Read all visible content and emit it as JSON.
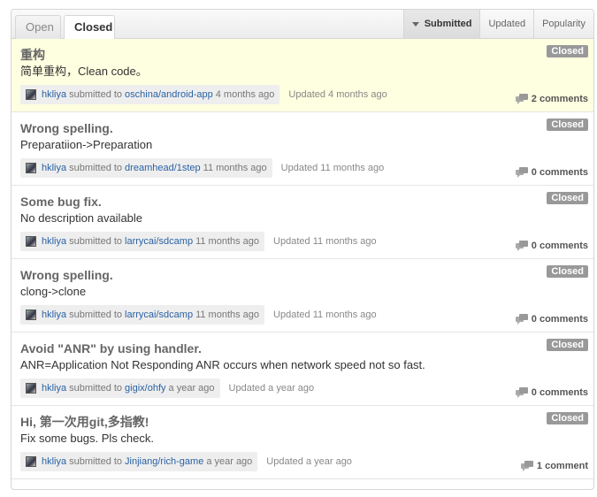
{
  "tabs": {
    "open": "Open",
    "closed": "Closed"
  },
  "sort": {
    "submitted": "Submitted",
    "updated": "Updated",
    "popularity": "Popularity"
  },
  "pulls": [
    {
      "title": "重构",
      "desc": "简单重构，Clean code。",
      "user": "hkliya",
      "submitted_to": "submitted to",
      "repo": "oschina/android-app",
      "ago": "4 months ago",
      "updated": "Updated 4 months ago",
      "state": "Closed",
      "comments": "2 comments",
      "highlight": true
    },
    {
      "title": "Wrong spelling.",
      "desc": "Preparatiion->Preparation",
      "user": "hkliya",
      "submitted_to": "submitted to",
      "repo": "dreamhead/1step",
      "ago": "11 months ago",
      "updated": "Updated 11 months ago",
      "state": "Closed",
      "comments": "0 comments"
    },
    {
      "title": "Some bug fix.",
      "desc": "No description available",
      "user": "hkliya",
      "submitted_to": "submitted to",
      "repo": "larrycai/sdcamp",
      "ago": "11 months ago",
      "updated": "Updated 11 months ago",
      "state": "Closed",
      "comments": "0 comments"
    },
    {
      "title": "Wrong spelling.",
      "desc": "clong->clone",
      "user": "hkliya",
      "submitted_to": "submitted to",
      "repo": "larrycai/sdcamp",
      "ago": "11 months ago",
      "updated": "Updated 11 months ago",
      "state": "Closed",
      "comments": "0 comments"
    },
    {
      "title": "Avoid \"ANR\" by using handler.",
      "desc": "ANR=Application Not Responding ANR occurs when network speed not so fast.",
      "user": "hkliya",
      "submitted_to": "submitted to",
      "repo": "gigix/ohfy",
      "ago": "a year ago",
      "updated": "Updated a year ago",
      "state": "Closed",
      "comments": "0 comments"
    },
    {
      "title": "Hi, 第一次用git,多指教!",
      "desc": "Fix some bugs. Pls check.",
      "user": "hkliya",
      "submitted_to": "submitted to",
      "repo": "Jinjiang/rich-game",
      "ago": "a year ago",
      "updated": "Updated a year ago",
      "state": "Closed",
      "comments": "1 comment"
    }
  ]
}
